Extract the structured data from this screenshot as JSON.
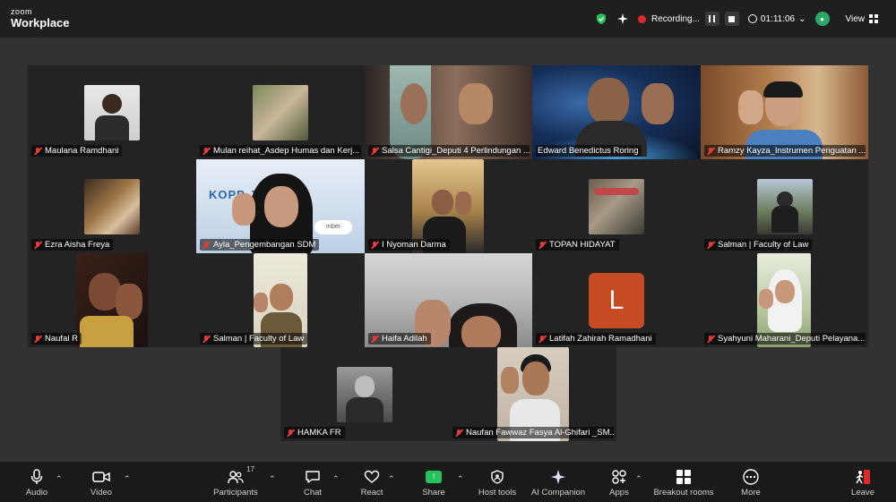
{
  "app": {
    "brand_line1": "zoom",
    "brand_line2": "Workplace"
  },
  "topbar": {
    "recording_label": "Recording...",
    "timer": "01:11:06",
    "view_label": "View",
    "accent": "#24c35b"
  },
  "participants": [
    {
      "name": "Maulana Ramdhani"
    },
    {
      "name": "Mulan reihat_Asdep Humas dan Kerj..."
    },
    {
      "name": "Salsa Cantigi_Deputi 4 Perlindungan ..."
    },
    {
      "name": "Edward Benedictus Roring"
    },
    {
      "name": "Ramzy Kayza_Instrumen Penguatan ..."
    },
    {
      "name": "Ezra Aisha Freya"
    },
    {
      "name": "Ayla_Pengembangan SDM"
    },
    {
      "name": "I Nyoman Darma"
    },
    {
      "name": "TOPAN HIDAYAT"
    },
    {
      "name": "Salman | Faculty of Law"
    },
    {
      "name": "Naufal R"
    },
    {
      "name": "Salman | Faculty of Law"
    },
    {
      "name": "Haifa Adilah"
    },
    {
      "name": "Latifah Zahirah Ramadhani",
      "initial": "L"
    },
    {
      "name": "Syahyuni Maharani_Deputi Pelayana..."
    },
    {
      "name": "HAMKA FR"
    },
    {
      "name": "Naufan Fawwaz Fasya Al-Ghifari _SM..."
    }
  ],
  "banner_text": "KOPP     JABAR",
  "banner_small": "mber",
  "toolbar": {
    "audio": "Audio",
    "video": "Video",
    "participants": "Participants",
    "participants_count": "17",
    "chat": "Chat",
    "react": "React",
    "share": "Share",
    "host_tools": "Host tools",
    "ai_companion": "AI Companion",
    "apps": "Apps",
    "breakout_rooms": "Breakout rooms",
    "more": "More",
    "leave": "Leave"
  }
}
